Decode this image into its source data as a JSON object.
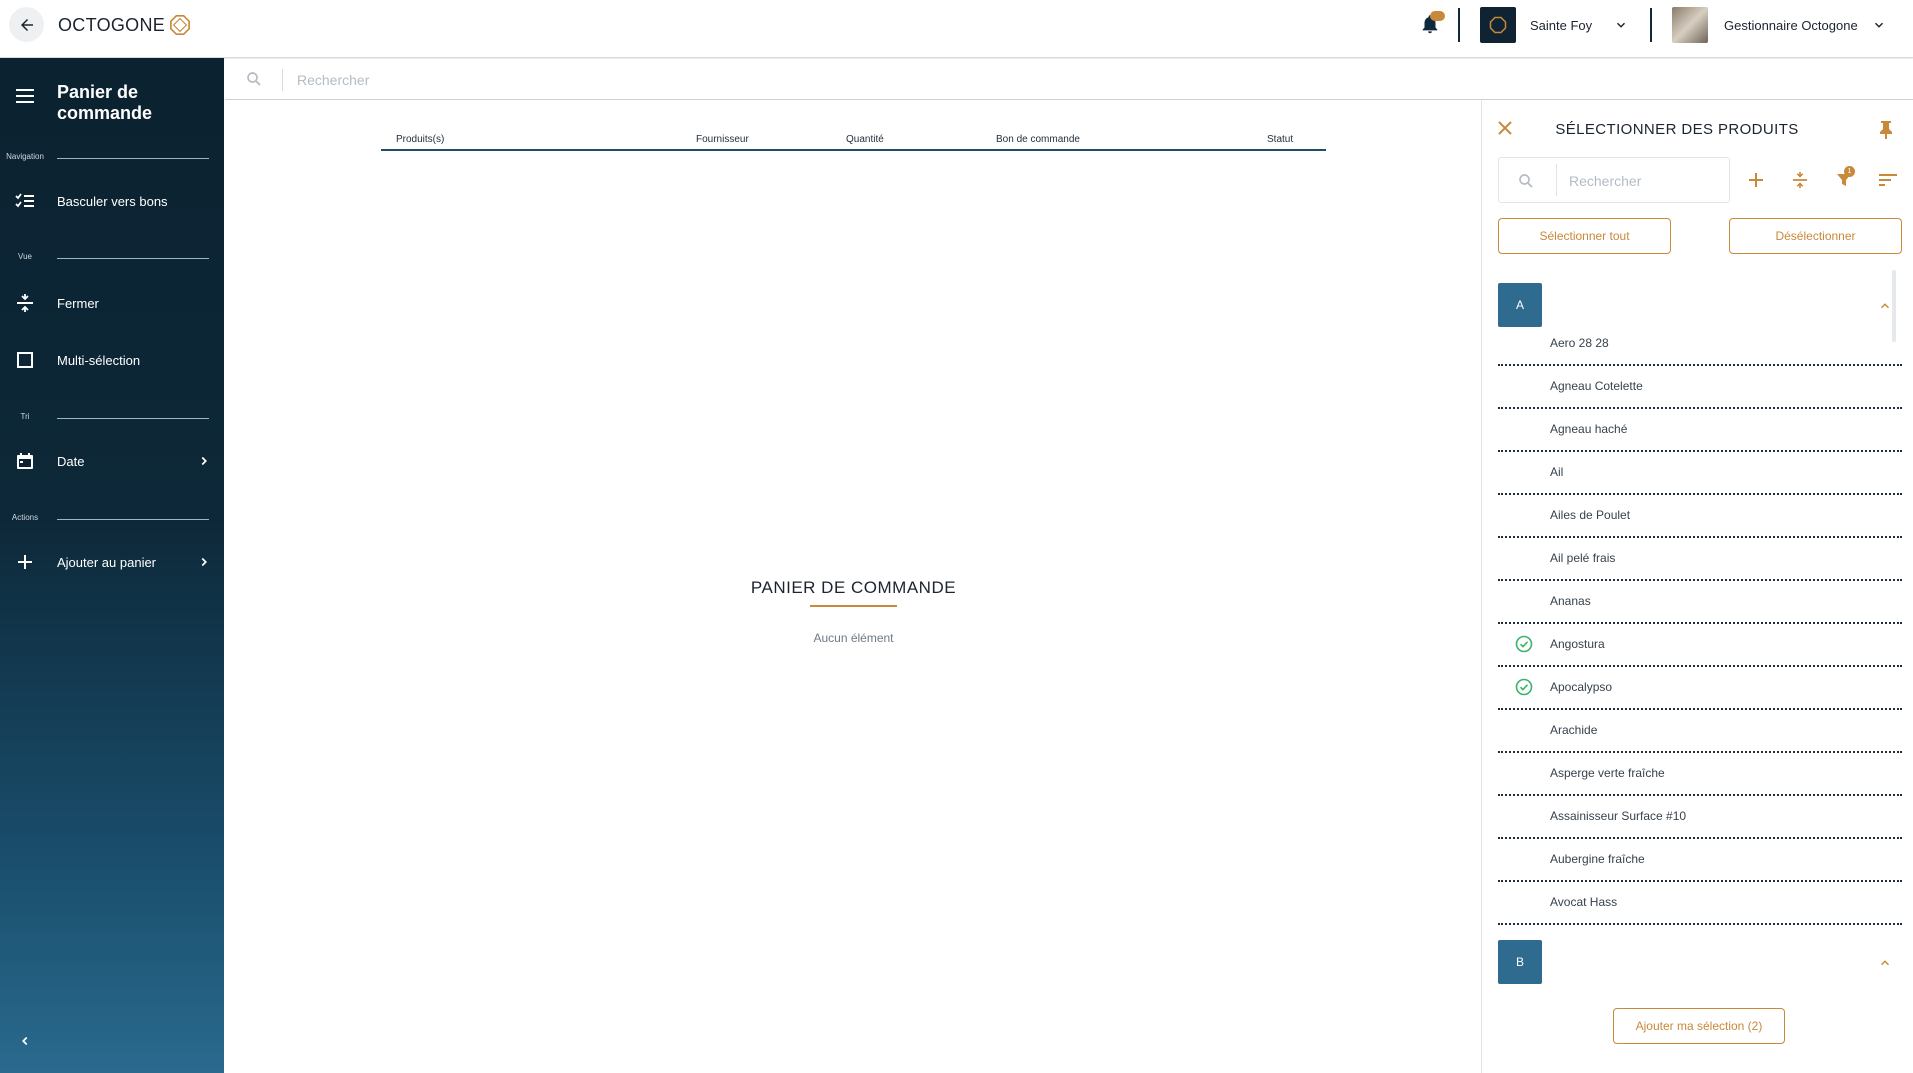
{
  "app": {
    "brand": "OCTOGONE",
    "site_name": "Sainte Foy",
    "user_name": "Gestionnaire Octogone"
  },
  "colors": {
    "accent": "#c8893a",
    "sidebar_dark": "#0b2230",
    "group_letter_bg": "#2f6a8f",
    "check_green": "#3bb36b"
  },
  "sidebar": {
    "title": "Panier de commande",
    "sections": {
      "navigation": "Navigation",
      "view": "Vue",
      "sort": "Tri",
      "actions": "Actions"
    },
    "items": {
      "switch": "Basculer vers bons",
      "close": "Fermer",
      "multi": "Multi-sélection",
      "date": "Date",
      "add_cart": "Ajouter au panier"
    }
  },
  "main": {
    "search_placeholder": "Rechercher",
    "columns": {
      "products": "Produits(s)",
      "supplier": "Fournisseur",
      "quantity": "Quantité",
      "order": "Bon de commande",
      "status": "Statut"
    },
    "empty_title": "PANIER DE COMMANDE",
    "empty_sub": "Aucun élément"
  },
  "panel": {
    "title": "SÉLECTIONNER DES PRODUITS",
    "search_placeholder": "Rechercher",
    "filter_count": "1",
    "select_all": "Sélectionner tout",
    "deselect": "Désélectionner",
    "group_a": "A",
    "group_b": "B",
    "items": [
      {
        "label": "Aero 28 28",
        "checked": false
      },
      {
        "label": "Agneau Cotelette",
        "checked": false
      },
      {
        "label": "Agneau haché",
        "checked": false
      },
      {
        "label": "Ail",
        "checked": false
      },
      {
        "label": "Ailes de Poulet",
        "checked": false
      },
      {
        "label": "Ail pelé frais",
        "checked": false
      },
      {
        "label": "Ananas",
        "checked": false
      },
      {
        "label": "Angostura",
        "checked": true
      },
      {
        "label": "Apocalypso",
        "checked": true
      },
      {
        "label": "Arachide",
        "checked": false
      },
      {
        "label": "Asperge verte fraîche",
        "checked": false
      },
      {
        "label": "Assainisseur Surface #10",
        "checked": false
      },
      {
        "label": "Aubergine fraîche",
        "checked": false
      },
      {
        "label": "Avocat Hass",
        "checked": false
      }
    ],
    "add_selection": "Ajouter ma sélection (2)"
  }
}
